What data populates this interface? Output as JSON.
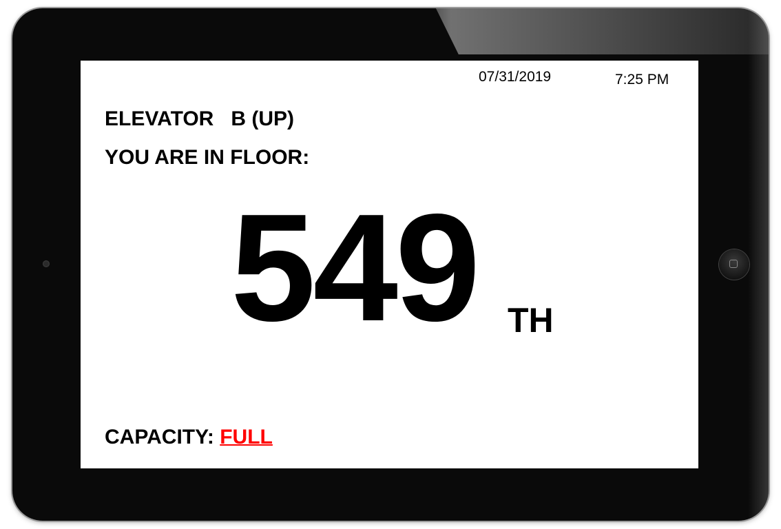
{
  "header": {
    "date": "07/31/2019",
    "time": "7:25 PM"
  },
  "elevator": {
    "label": "ELEVATOR",
    "car": "B (UP)"
  },
  "location": {
    "label": "YOU ARE IN FLOOR:",
    "floor": "549",
    "suffix": "TH"
  },
  "capacity": {
    "label": "CAPACITY:",
    "value": "FULL",
    "value_color": "#ff0000"
  },
  "device": {
    "icons": [
      "camera-icon",
      "home-button-icon"
    ]
  }
}
